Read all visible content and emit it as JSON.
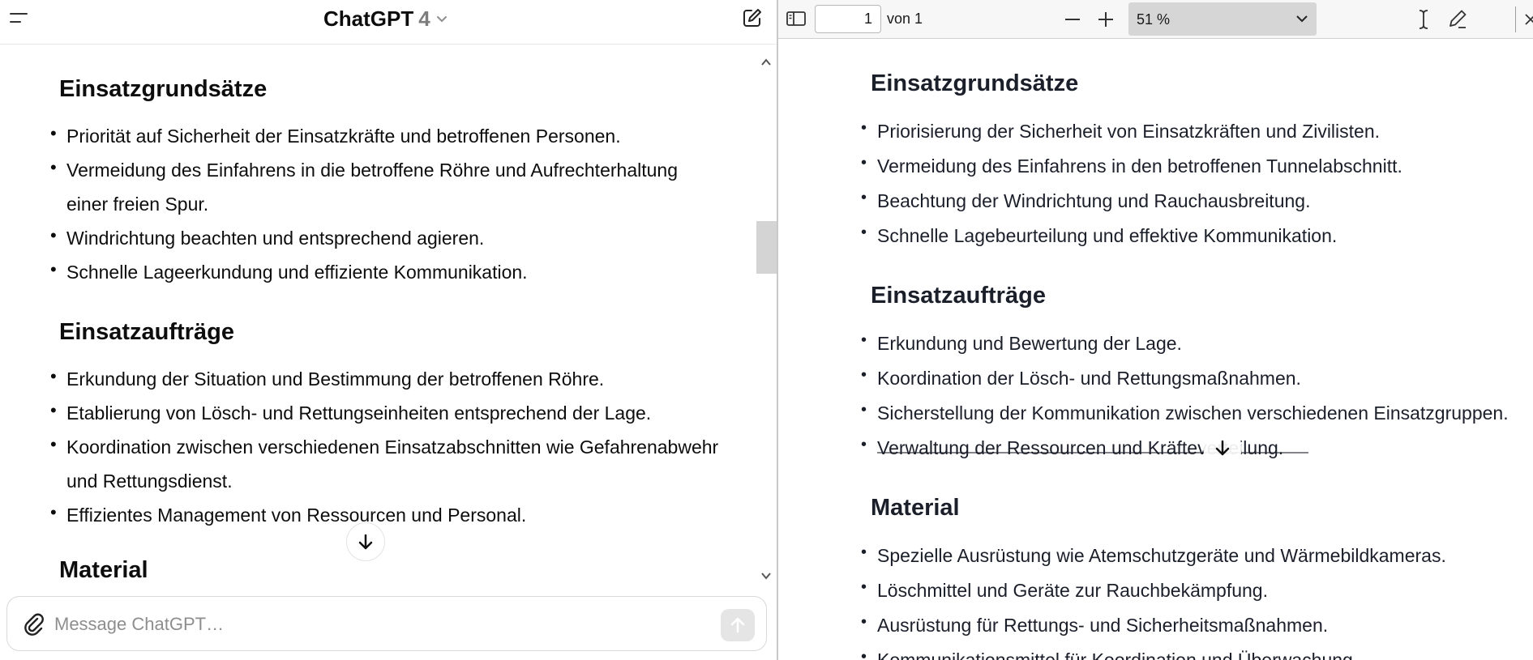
{
  "chat": {
    "header": {
      "model_name": "ChatGPT",
      "model_version": "4"
    },
    "sections": [
      {
        "heading": "Einsatzgrundsätze",
        "items": [
          "Priorität auf Sicherheit der Einsatzkräfte und betroffenen Personen.",
          "Vermeidung des Einfahrens in die betroffene Röhre und Aufrechterhaltung einer freien Spur.",
          "Windrichtung beachten und entsprechend agieren.",
          "Schnelle Lageerkundung und effiziente Kommunikation."
        ]
      },
      {
        "heading": "Einsatzaufträge",
        "items": [
          "Erkundung der Situation und Bestimmung der betroffenen Röhre.",
          "Etablierung von Lösch- und Rettungseinheiten entsprechend der Lage.",
          "Koordination zwischen verschiedenen Einsatzabschnitten wie Gefahrenabwehr und Rettungsdienst.",
          "Effizientes Management von Ressourcen und Personal."
        ]
      },
      {
        "heading": "Material",
        "items": []
      }
    ],
    "composer": {
      "placeholder": "Message ChatGPT…"
    },
    "icons": {
      "menu": "menu-icon",
      "new_chat": "new-chat-icon",
      "attach": "paperclip-icon",
      "send": "arrow-up-icon",
      "scroll_down": "arrow-down-icon"
    }
  },
  "pdf": {
    "toolbar": {
      "page_number": "1",
      "page_of": "von 1",
      "zoom": "51 %"
    },
    "sections": [
      {
        "heading": "Einsatzgrundsätze",
        "items": [
          "Priorisierung der Sicherheit von Einsatzkräften und Zivilisten.",
          "Vermeidung des Einfahrens in den betroffenen Tunnelabschnitt.",
          "Beachtung der Windrichtung und Rauchausbreitung.",
          "Schnelle Lagebeurteilung und effektive Kommunikation."
        ]
      },
      {
        "heading": "Einsatzaufträge",
        "items": [
          "Erkundung und Bewertung der Lage.",
          "Koordination der Lösch- und Rettungsmaßnahmen.",
          "Sicherstellung der Kommunikation zwischen verschiedenen Einsatzgruppen.",
          "Verwaltung der Ressourcen und Kräfteverteilung."
        ]
      },
      {
        "heading": "Material",
        "items": [
          "Spezielle Ausrüstung wie Atemschutzgeräte und Wärmebildkameras.",
          "Löschmittel und Geräte zur Rauchbekämpfung.",
          "Ausrüstung für Rettungs- und Sicherheitsmaßnahmen.",
          "Kommunikationsmittel für Koordination und Überwachung."
        ]
      }
    ],
    "icons": {
      "sidebar": "sidebar-toggle-icon",
      "zoom_out": "minus-icon",
      "zoom_in": "plus-icon",
      "text_select": "text-cursor-icon",
      "draw": "pen-icon"
    }
  },
  "colors": {
    "text": "#0d0d0d",
    "muted": "#7d7d7d",
    "pdf_text": "#1b1f2a",
    "toolbar_bg": "#f7f7f7",
    "zoom_bg": "#d6d6d6"
  }
}
